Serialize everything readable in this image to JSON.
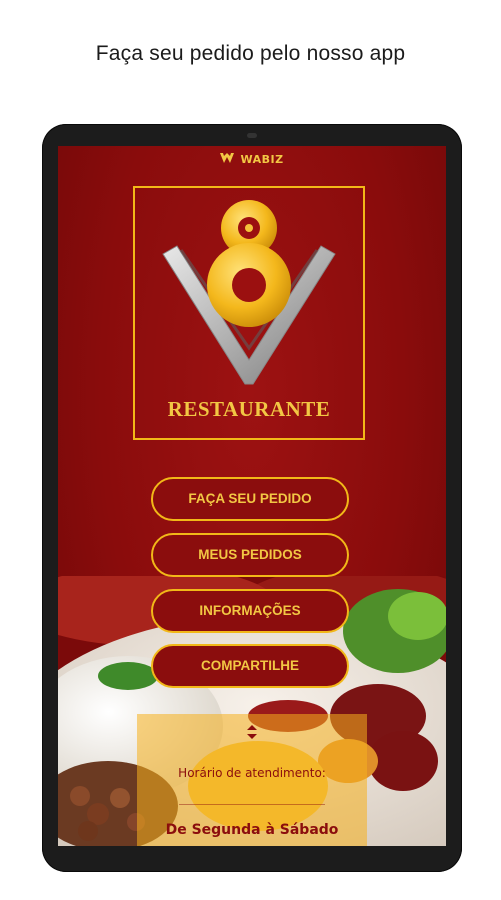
{
  "headline": "Faça seu pedido pelo nosso app",
  "brand": {
    "name": "WABIZ"
  },
  "logo": {
    "number": "8",
    "text": "RESTAURANTE"
  },
  "menu": {
    "items": [
      {
        "label": "FAÇA SEU PEDIDO"
      },
      {
        "label": "MEUS PEDIDOS"
      },
      {
        "label": "INFORMAÇÕES"
      },
      {
        "label": "COMPARTILHE"
      }
    ]
  },
  "hours": {
    "label": "Horário de atendimento:",
    "days": "De Segunda à Sábado"
  },
  "colors": {
    "background": "#8b0d0d",
    "accent": "#f2b818",
    "text_accent": "#f2c744"
  },
  "icons": [
    "wabiz-logo-icon",
    "chevron-up-down-icon"
  ]
}
